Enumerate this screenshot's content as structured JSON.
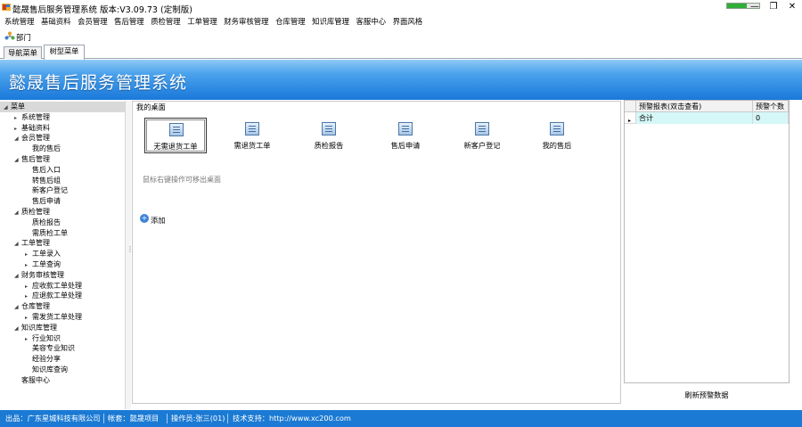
{
  "window": {
    "title": "懿晟售后服务管理系统 版本:V3.09.73 (定制版)",
    "progress_fraction": 0.6,
    "minimize_glyph": "—",
    "restore_glyph": "❐",
    "close_glyph": "✕"
  },
  "menubar": [
    "系统管理",
    "基础资料",
    "会员管理",
    "售后管理",
    "质检管理",
    "工单管理",
    "财务审核管理",
    "仓库管理",
    "知识库管理",
    "客服中心",
    "界面风格"
  ],
  "toolbar": {
    "department_label": "部门"
  },
  "tabs": [
    {
      "label": "导航菜单",
      "active": false
    },
    {
      "label": "树型菜单",
      "active": true
    }
  ],
  "banner": {
    "title": "懿晟售后服务管理系统"
  },
  "tree": [
    {
      "label": "菜单",
      "level": 0,
      "arrow": "◢",
      "selected": true
    },
    {
      "label": "系统管理",
      "level": 1,
      "arrow": "▸"
    },
    {
      "label": "基础资料",
      "level": 1,
      "arrow": "▸"
    },
    {
      "label": "会员管理",
      "level": 1,
      "arrow": "◢"
    },
    {
      "label": "我的售后",
      "level": 2,
      "arrow": ""
    },
    {
      "label": "售后管理",
      "level": 1,
      "arrow": "◢"
    },
    {
      "label": "售后入口",
      "level": 2,
      "arrow": ""
    },
    {
      "label": "转售后组",
      "level": 2,
      "arrow": ""
    },
    {
      "label": "新客户登记",
      "level": 2,
      "arrow": ""
    },
    {
      "label": "售后申请",
      "level": 2,
      "arrow": ""
    },
    {
      "label": "质检管理",
      "level": 1,
      "arrow": "◢"
    },
    {
      "label": "质检报告",
      "level": 2,
      "arrow": ""
    },
    {
      "label": "需质检工单",
      "level": 2,
      "arrow": ""
    },
    {
      "label": "工单管理",
      "level": 1,
      "arrow": "◢"
    },
    {
      "label": "工单录入",
      "level": 2,
      "arrow": "▸"
    },
    {
      "label": "工单查询",
      "level": 2,
      "arrow": "▸"
    },
    {
      "label": "财务审核管理",
      "level": 1,
      "arrow": "◢"
    },
    {
      "label": "应收款工单处理",
      "level": 2,
      "arrow": "▸"
    },
    {
      "label": "应退款工单处理",
      "level": 2,
      "arrow": "▸"
    },
    {
      "label": "仓库管理",
      "level": 1,
      "arrow": "◢"
    },
    {
      "label": "需发货工单处理",
      "level": 2,
      "arrow": "▸"
    },
    {
      "label": "知识库管理",
      "level": 1,
      "arrow": "◢"
    },
    {
      "label": "行业知识",
      "level": 2,
      "arrow": "▸"
    },
    {
      "label": "美容专业知识",
      "level": 2,
      "arrow": ""
    },
    {
      "label": "经验分享",
      "level": 2,
      "arrow": ""
    },
    {
      "label": "知识库查询",
      "level": 2,
      "arrow": ""
    },
    {
      "label": "客服中心",
      "level": 1,
      "arrow": ""
    }
  ],
  "desk": {
    "legend": "我的桌面",
    "shortcuts": [
      "无需退货工单",
      "需退货工单",
      "质检报告",
      "售后申请",
      "新客户登记",
      "我的售后"
    ],
    "hint": "鼠标右键操作可移出桌面",
    "add_label": "添加",
    "add_glyph": "+"
  },
  "alert_table": {
    "headers": [
      "预警报表(双击查看)",
      "预警个数"
    ],
    "rows": [
      {
        "name": "合计",
        "count": "0"
      }
    ],
    "row_indicator": "▸",
    "refresh_label": "刷新预警数据"
  },
  "statusbar": {
    "producer": "出品：广东星城科技有限公司",
    "account": "帐套：懿晟项目",
    "operator": "操作员:张三(01)",
    "support": "技术支持：http://www.xc200.com"
  },
  "colors": {
    "banner": "#1979da",
    "status": "#1b7ad3",
    "selected_row": "#d5f7f7"
  }
}
